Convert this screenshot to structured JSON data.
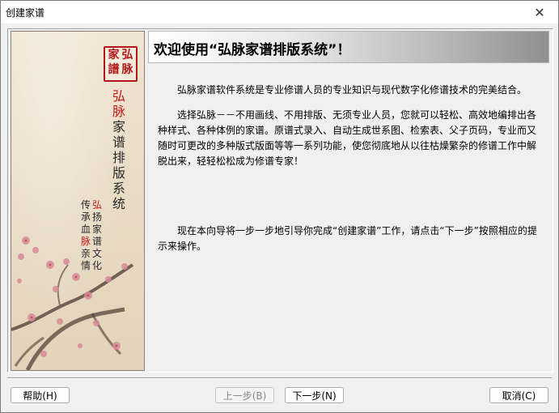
{
  "window": {
    "title": "创建家谱",
    "close_glyph": "✕"
  },
  "side_panel": {
    "seal": [
      "弘",
      "家",
      "脉",
      "譜"
    ],
    "vertical_title": [
      "弘",
      "脉",
      "家",
      "谱",
      "排",
      "版",
      "系",
      "统"
    ],
    "col_left": [
      "传",
      "承",
      "血",
      "脉",
      "亲",
      "情"
    ],
    "col_right": [
      "弘",
      "扬",
      "家",
      "谱",
      "文",
      "化"
    ]
  },
  "header": {
    "title": "欢迎使用“弘脉家谱排版系统”！"
  },
  "body": {
    "p1": "弘脉家谱软件系统是专业修谱人员的专业知识与现代数字化修谱技术的完美结合。",
    "p2": "选择弘脉－－不用画线、不用排版、无须专业人员，您就可以轻松、高效地编排出各种样式、各种体例的家谱。原谱式录入、自动生成世系图、检索表、父子页码，专业而又随时可更改的多种版式版面等等一系列功能，使您彻底地从以往枯燥繁杂的修谱工作中解脱出来，轻轻松松成为修谱专家！",
    "p3": "现在本向导将一步一步地引导你完成“创建家谱”工作，请点击“下一步”按照相应的提示来操作。"
  },
  "buttons": {
    "help": "帮助(H)",
    "prev": "上一步(B)",
    "next": "下一步(N)",
    "cancel": "取消(C)"
  }
}
